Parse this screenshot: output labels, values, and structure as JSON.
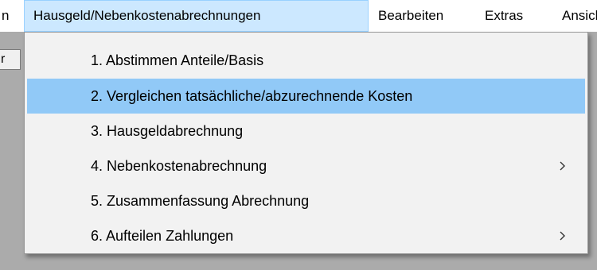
{
  "menubar": {
    "left_label": "n",
    "items": [
      {
        "label": "Hausgeld/Nebenkostenabrechnungen"
      },
      {
        "label": "Bearbeiten"
      },
      {
        "label": "Extras"
      },
      {
        "label": "Ansicht"
      }
    ]
  },
  "toolbar": {
    "partial_label": "r"
  },
  "dropdown": {
    "items": [
      {
        "label": "1. Abstimmen Anteile/Basis",
        "submenu": false
      },
      {
        "label": "2. Vergleichen tatsächliche/abzurechnende Kosten",
        "submenu": false,
        "highlighted": true
      },
      {
        "label": "3. Hausgeldabrechnung",
        "submenu": false
      },
      {
        "label": "4. Nebenkostenabrechnung",
        "submenu": true
      },
      {
        "label": "5. Zusammenfassung Abrechnung",
        "submenu": false
      },
      {
        "label": "6. Aufteilen Zahlungen",
        "submenu": true
      }
    ]
  },
  "colors": {
    "menubar_open_bg": "#cce8ff",
    "highlight_bg": "#91c9f7",
    "dropdown_bg": "#f2f2f2",
    "workspace_bg": "#ababab"
  }
}
